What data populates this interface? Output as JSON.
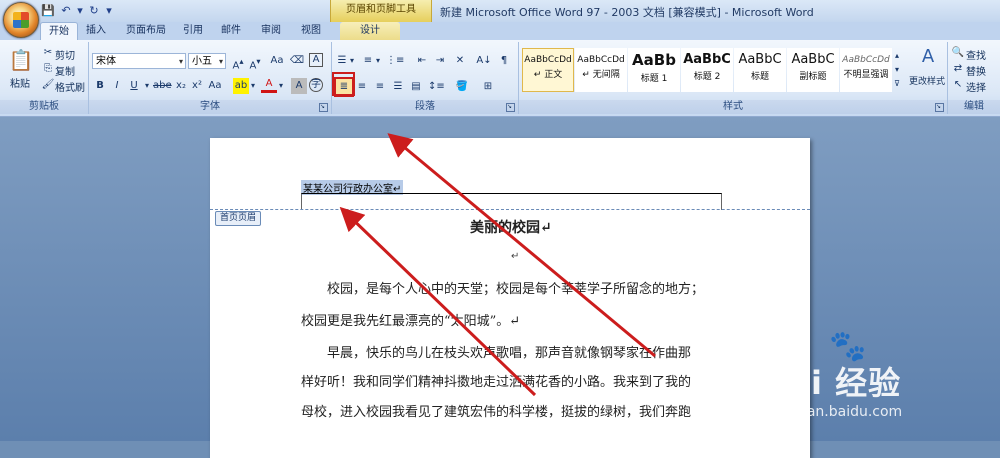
{
  "window": {
    "title": "新建 Microsoft Office Word 97 - 2003 文档 [兼容模式] - Microsoft Word",
    "context_tool": "页眉和页脚工具"
  },
  "tabs": [
    "开始",
    "插入",
    "页面布局",
    "引用",
    "邮件",
    "审阅",
    "视图",
    "设计"
  ],
  "clipboard": {
    "paste": "粘贴",
    "cut": "剪切",
    "copy": "复制",
    "format_painter": "格式刷",
    "label": "剪贴板"
  },
  "font": {
    "name": "宋体",
    "size": "小五",
    "label": "字体"
  },
  "paragraph": {
    "label": "段落"
  },
  "styles": {
    "label": "样式",
    "items": [
      {
        "sample": "AaBbCcDd",
        "name": "↵ 正文"
      },
      {
        "sample": "AaBbCcDd",
        "name": "↵ 无间隔"
      },
      {
        "sample": "AaBb",
        "name": "标题 1"
      },
      {
        "sample": "AaBbC",
        "name": "标题 2"
      },
      {
        "sample": "AaBbC",
        "name": "标题"
      },
      {
        "sample": "AaBbC",
        "name": "副标题"
      },
      {
        "sample": "AaBbCcDd",
        "name": "不明显强调"
      }
    ],
    "change_styles": "更改样式"
  },
  "editing": {
    "find": "查找",
    "replace": "替换",
    "select": "选择",
    "label": "编辑"
  },
  "document": {
    "header_text": "某某公司行政办公室↵",
    "header_tag": "首页页眉",
    "title": "美丽的校园↵",
    "lines": [
      "校园，是每个人心中的天堂；校园是每个莘莘学子所留念的地方；",
      "校园更是我先红最漂亮的“太阳城”。↵",
      "早晨，快乐的鸟儿在枝头欢声歌唱，那声音就像钢琴家在作曲那",
      "样好听！我和同学们精神抖擞地走过洒满花香的小路。我来到了我的",
      "母校，进入校园我看见了建筑宏伟的科学楼，挺拔的绿树，我们奔跑"
    ]
  },
  "watermark": {
    "brand": "Bai 经验",
    "url": "jingyan.baidu.com"
  },
  "colors": {
    "highlight_box": "#cc1d1d",
    "arrow": "#cc1d1d"
  }
}
